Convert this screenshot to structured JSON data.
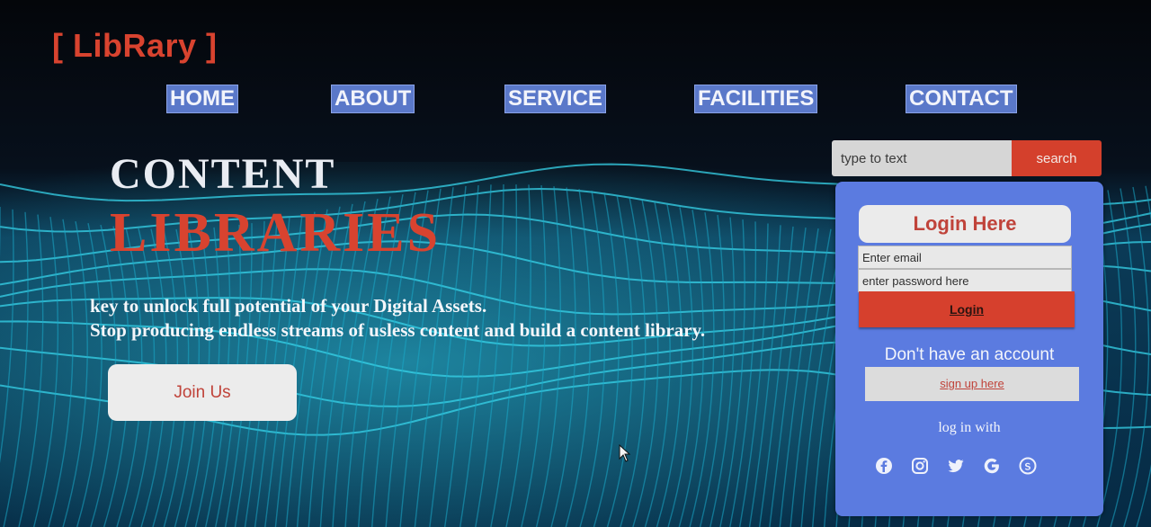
{
  "brand": {
    "logo_text": "[ LibRary ]"
  },
  "nav": {
    "items": [
      "HOME",
      "ABOUT",
      "SERVICE",
      "FACILITIES",
      "CONTACT"
    ]
  },
  "hero": {
    "title_line1": "CONTENT",
    "title_line2": "LIBRARIES",
    "tagline_line1": "key to unlock full potential of your Digital Assets.",
    "tagline_line2": "Stop producing endless streams of usless content and build a content library.",
    "join_button": "Join Us"
  },
  "search": {
    "placeholder": "type to text",
    "button_label": "search"
  },
  "login": {
    "heading": "Login Here",
    "email_placeholder": "Enter email",
    "password_placeholder": "enter password here",
    "login_button": "Login",
    "no_account_text": "Don't have an account",
    "signup_link": "sign up here",
    "login_with_text": "log in with",
    "social_icons": [
      "facebook-icon",
      "instagram-icon",
      "twitter-icon",
      "google-icon",
      "skype-icon"
    ]
  },
  "colors": {
    "accent_red": "#d8432f",
    "nav_blue": "#5a78c9",
    "panel_blue": "#5b7be0",
    "wave_cyan": "#2fd0e6"
  }
}
